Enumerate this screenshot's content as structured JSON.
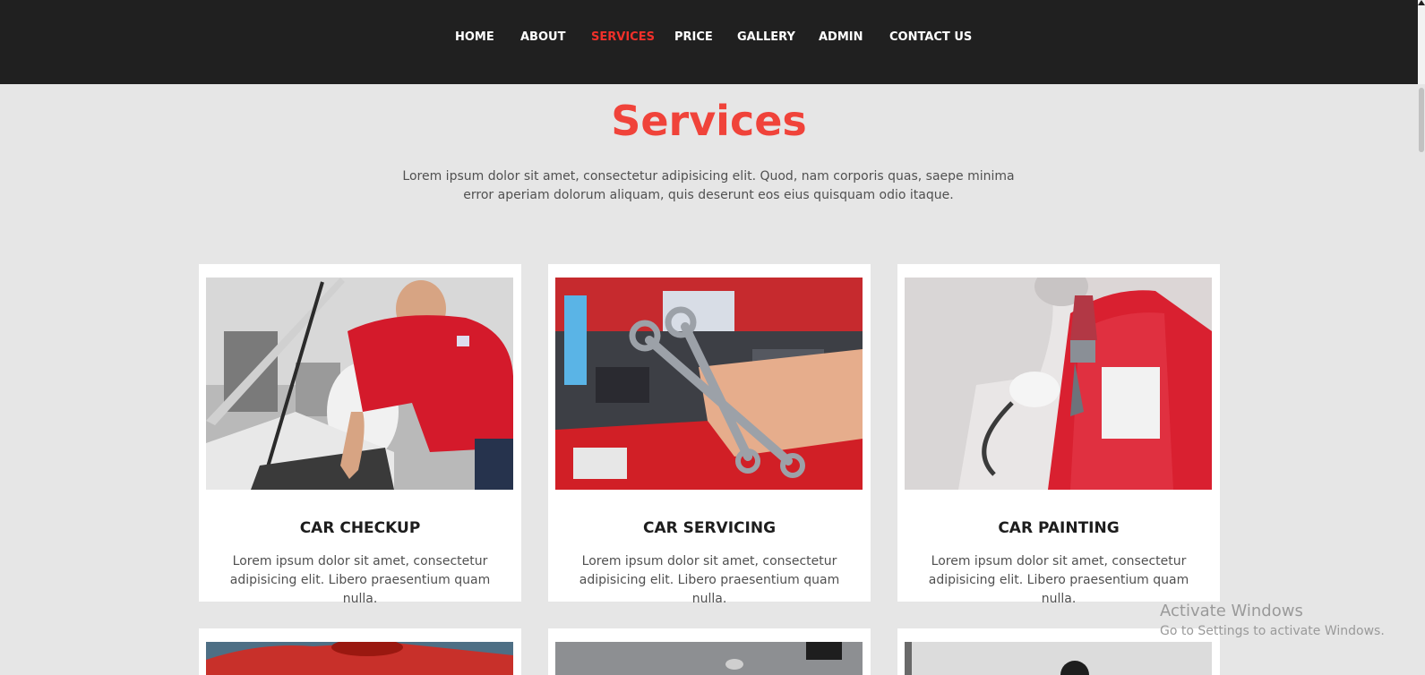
{
  "nav": {
    "items": [
      {
        "label": "HOME",
        "active": false
      },
      {
        "label": "ABOUT",
        "active": false
      },
      {
        "label": "SERVICES",
        "active": true
      },
      {
        "label": "PRICE",
        "active": false
      },
      {
        "label": "GALLERY",
        "active": false
      },
      {
        "label": "ADMIN",
        "active": false
      },
      {
        "label": "CONTACT US",
        "active": false
      }
    ]
  },
  "services": {
    "title": "Services",
    "description": "Lorem ipsum dolor sit amet, consectetur adipisicing elit. Quod, nam corporis quas, saepe minima error aperiam dolorum aliquam, quis deserunt eos eius quisquam odio itaque.",
    "cards": [
      {
        "title": "CAR CHECKUP",
        "text": "Lorem ipsum dolor sit amet, consectetur adipisicing elit. Libero praesentium quam nulla.",
        "image": "mechanic-checking-engine"
      },
      {
        "title": "CAR SERVICING",
        "text": "Lorem ipsum dolor sit amet, consectetur adipisicing elit. Libero praesentium quam nulla.",
        "image": "hand-holding-wrenches"
      },
      {
        "title": "CAR PAINTING",
        "text": "Lorem ipsum dolor sit amet, consectetur adipisicing elit. Libero praesentium quam nulla.",
        "image": "spray-painting-car"
      }
    ]
  },
  "watermark": {
    "title": "Activate Windows",
    "subtitle": "Go to Settings to activate Windows."
  },
  "colors": {
    "accent": "#f0433a",
    "nav_bg": "#202020",
    "page_bg": "#e6e6e6"
  }
}
